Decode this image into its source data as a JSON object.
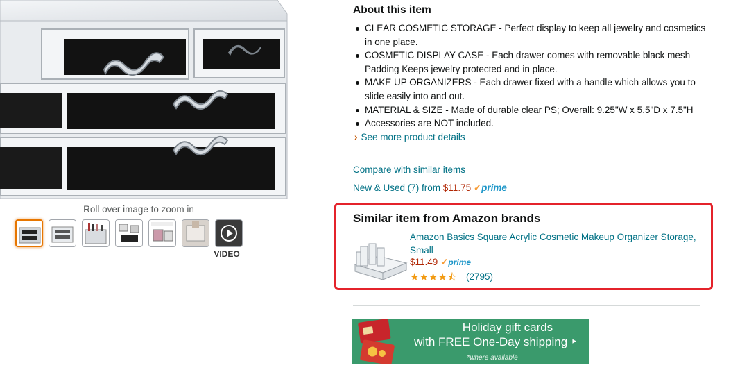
{
  "gallery": {
    "zoom_hint": "Roll over image to zoom in",
    "video_label": "VIDEO",
    "thumbnail_count": 7
  },
  "about": {
    "title": "About this item",
    "bullets": [
      "CLEAR COSMETIC STORAGE - Perfect display to keep all jewelry and cosmetics in one place.",
      "COSMETIC DISPLAY CASE - Each drawer comes with removable black mesh Padding Keeps jewelry protected and in place.",
      "MAKE UP ORGANIZERS - Each drawer fixed with a handle which allows you to slide easily into and out.",
      "MATERIAL & SIZE - Made of durable clear PS; Overall: 9.25\"W x 5.5\"D x 7.5\"H",
      "Accessories are NOT included."
    ],
    "see_more": "See more product details"
  },
  "offers": {
    "compare_link": "Compare with similar items",
    "new_used_prefix": "New & Used (7) from",
    "new_used_price": "$11.75",
    "prime_check": "✓",
    "prime_word": "prime"
  },
  "similar": {
    "title": "Similar item from Amazon brands",
    "name": "Amazon Basics Square Acrylic Cosmetic Makeup Organizer Storage, Small",
    "price": "$11.49",
    "stars": "★★★★⯪",
    "rating_value": 4.5,
    "review_count": "(2795)"
  },
  "banner": {
    "line1": "Holiday gift cards",
    "line2": "with FREE One-Day shipping ‣",
    "note": "*where available"
  },
  "colors": {
    "link": "#007185",
    "price": "#b12704",
    "highlight_border": "#e4232b",
    "banner_bg": "#3a9a6c",
    "star": "#f29a12"
  }
}
